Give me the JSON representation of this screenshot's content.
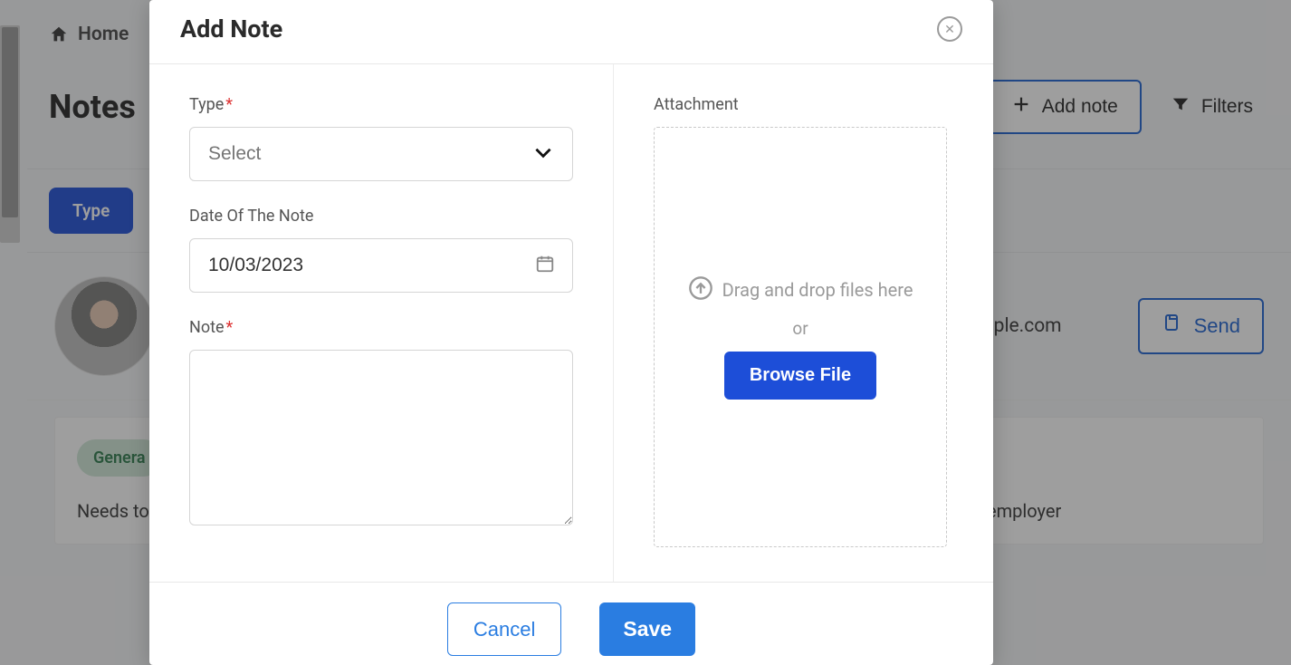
{
  "breadcrumb": {
    "home": "Home"
  },
  "page": {
    "title": "Notes",
    "add_note_label": "Add note",
    "filters_label": "Filters"
  },
  "filters": {
    "chip_type": "Type"
  },
  "user": {
    "email": "tch@example.com",
    "send_label": "Send"
  },
  "note_card": {
    "tag": "Genera",
    "body_prefix": "Needs to ",
    "body_suffix": "s employer"
  },
  "modal": {
    "title": "Add Note",
    "type_label": "Type",
    "type_placeholder": "Select",
    "date_label": "Date Of The Note",
    "date_value": "10/03/2023",
    "note_label": "Note",
    "attachment_label": "Attachment",
    "drop_text": "Drag and drop files here",
    "or_text": "or",
    "browse_label": "Browse File",
    "cancel_label": "Cancel",
    "save_label": "Save"
  }
}
